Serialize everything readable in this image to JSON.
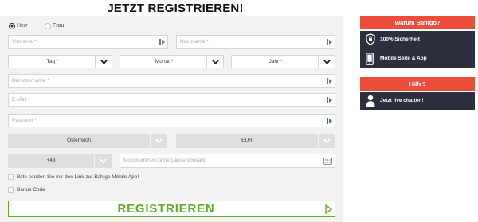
{
  "page": {
    "title": "JETZT REGISTRIEREN!"
  },
  "form": {
    "salutation": {
      "option_1": "Herr",
      "option_2": "Frau",
      "selected": "Herr"
    },
    "first_name": {
      "placeholder": "Vorname *"
    },
    "last_name": {
      "placeholder": "Nachname *"
    },
    "birth_day": {
      "value": "Tag *"
    },
    "birth_month": {
      "value": "Monat *"
    },
    "birth_year": {
      "value": "Jahr *"
    },
    "username": {
      "placeholder": "Benutzername *"
    },
    "email": {
      "placeholder": "E-Mail *"
    },
    "password": {
      "placeholder": "Passwort *"
    },
    "country": {
      "value": "Österreich"
    },
    "currency": {
      "value": "EUR"
    },
    "phone_prefix": {
      "value": "+43"
    },
    "mobile": {
      "placeholder": "Mobilnummer (ohne Ländervorwahl)"
    },
    "app_link_checkbox": {
      "label": "Bitte senden Sie mir den Link zur Bahigo Mobile App!",
      "checked": false
    },
    "bonus_code_checkbox": {
      "label": "Bonus Code",
      "checked": false
    },
    "submit": {
      "label": "REGISTRIEREN"
    }
  },
  "sidebar": {
    "why": {
      "title": "Warum Bahigo?",
      "items": [
        {
          "label": "100% Sicherheit",
          "icon": "shield-lock-icon"
        },
        {
          "label": "Mobile Seite & App",
          "icon": "smartphone-icon"
        }
      ]
    },
    "help": {
      "title": "Hilfe?",
      "items": [
        {
          "label": "Jetzt live chatten!",
          "icon": "person-icon"
        }
      ]
    }
  },
  "colors": {
    "accent_green": "#5fae2e",
    "panel_red": "#ec4c3a",
    "panel_dark": "#2d2f3e",
    "form_background": "#f2f2f2"
  }
}
